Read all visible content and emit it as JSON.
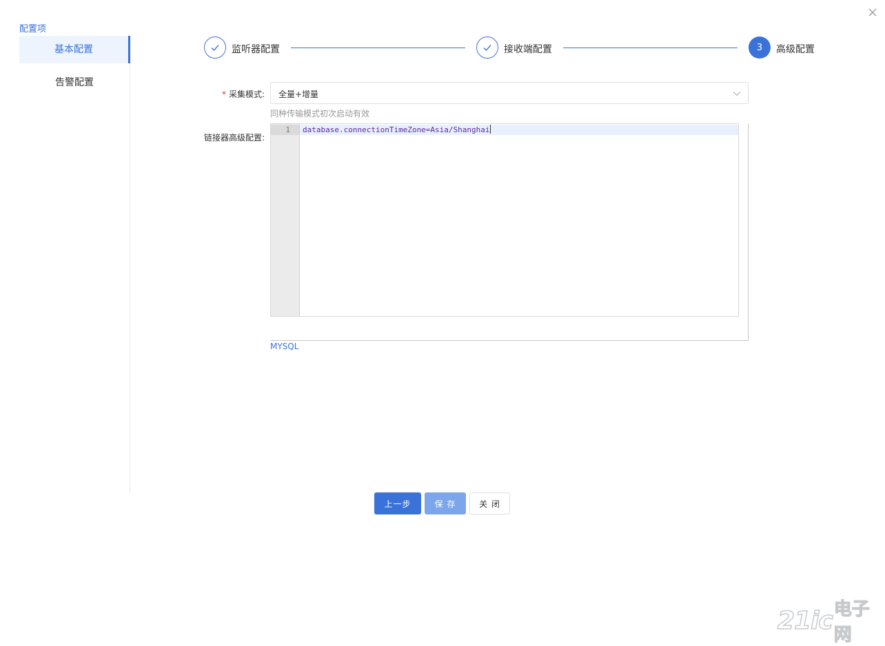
{
  "dialog": {
    "close_icon": "close-icon"
  },
  "sidebar": {
    "title": "配置项",
    "items": [
      {
        "label": "基本配置",
        "active": true
      },
      {
        "label": "告警配置",
        "active": false
      }
    ]
  },
  "steps": [
    {
      "label": "监听器配置",
      "status": "done",
      "icon": "check-icon"
    },
    {
      "label": "接收端配置",
      "status": "done",
      "icon": "check-icon"
    },
    {
      "label": "高级配置",
      "status": "current",
      "number": "3"
    }
  ],
  "form": {
    "mode": {
      "required_mark": "*",
      "label": "采集模式:",
      "value": "全量+增量",
      "hint": "同种传输模式初次启动有效"
    },
    "advanced": {
      "label": "链接器高级配置:",
      "line_number": "1",
      "code": "database.connectionTimeZone=Asia/Shanghai",
      "type_link": "MYSQL"
    }
  },
  "buttons": {
    "prev": "上一步",
    "save": "保 存",
    "close": "关 闭"
  },
  "watermark": {
    "text_a": "21ic",
    "text_b": "电子网"
  },
  "colors": {
    "primary": "#3a72d9",
    "primary_light": "#7ba6ec",
    "required": "#e5323e",
    "hint": "#999999"
  }
}
